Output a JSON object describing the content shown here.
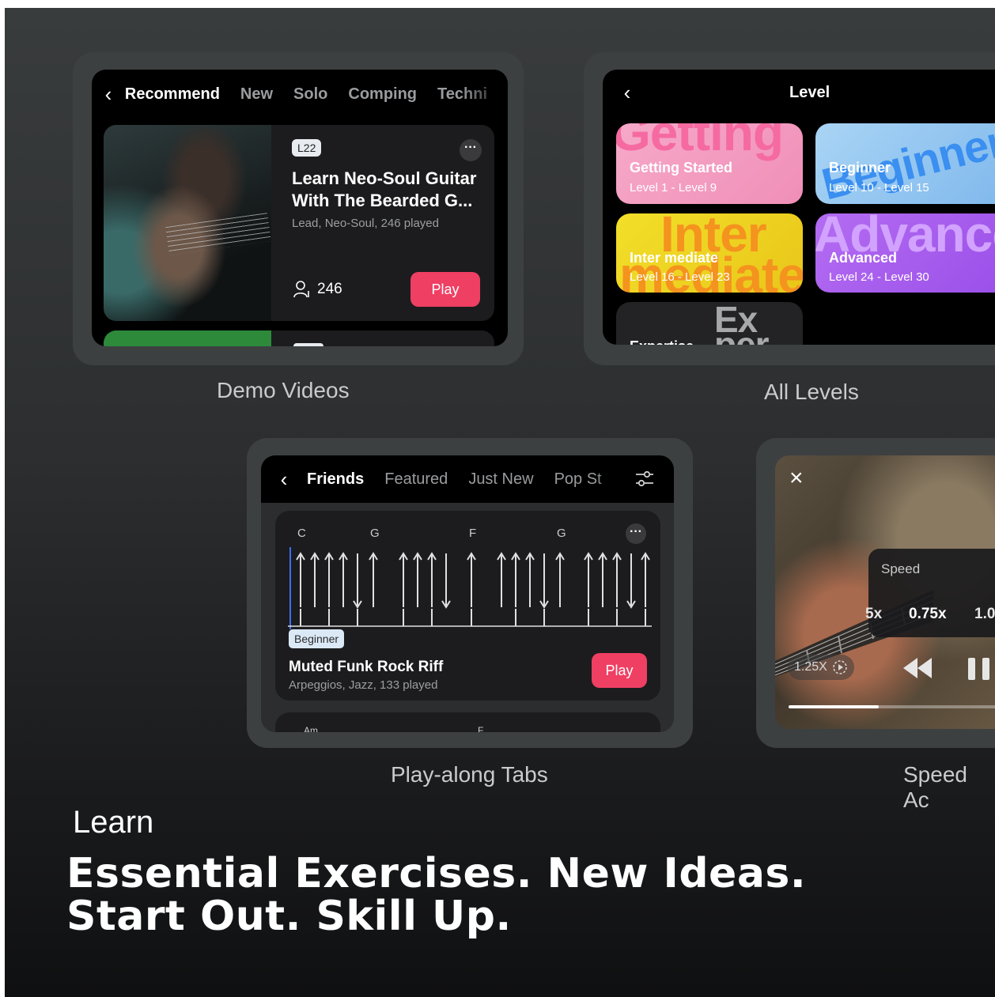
{
  "demo": {
    "tabs": [
      "Recommend",
      "New",
      "Solo",
      "Comping",
      "Techni"
    ],
    "video": {
      "level_badge": "L22",
      "title_line1": "Learn Neo-Soul Guitar",
      "title_line2": "With The Bearded G...",
      "subtitle": "Lead, Neo-Soul, 246 played",
      "count": "246",
      "play_label": "Play"
    },
    "caption": "Demo Videos"
  },
  "levels": {
    "title": "Level",
    "tiles": [
      {
        "big": "Getting",
        "name": "Getting Started",
        "range": "Level 1 - Level 9"
      },
      {
        "big": "Beginner",
        "name": "Beginner",
        "range": "Level 10 - Level 15"
      },
      {
        "big": "Inter",
        "big2": "mediate",
        "name": "Inter mediate",
        "range": "Level 16 - Level 23"
      },
      {
        "big": "Advanced",
        "name": "Advanced",
        "range": "Level 24 - Level 30"
      },
      {
        "big": "Ex",
        "big2": "per",
        "name": "Expertise",
        "range": ""
      }
    ],
    "caption": "All Levels"
  },
  "playalong": {
    "tabs": [
      "Friends",
      "Featured",
      "Just New",
      "Pop St"
    ],
    "chords": [
      "C",
      "G",
      "F",
      "G"
    ],
    "badge": "Beginner",
    "title": "Muted Funk Rock Riff",
    "subtitle": "Arpeggios, Jazz, 133 played",
    "play_label": "Play",
    "peek_chords": [
      "Am",
      "F"
    ],
    "caption": "Play-along Tabs"
  },
  "speed": {
    "panel_title": "Speed",
    "options": [
      "5x",
      "0.75x",
      "1.0"
    ],
    "current": "1.25X",
    "caption": "Speed Ac",
    "progress": 0.38
  },
  "hero": {
    "label": "Learn",
    "line1": "Essential Exercises. New Ideas.",
    "line2": "Start Out. Skill Up."
  },
  "colors": {
    "accent": "#ef3f63",
    "card": "#3d4041"
  }
}
